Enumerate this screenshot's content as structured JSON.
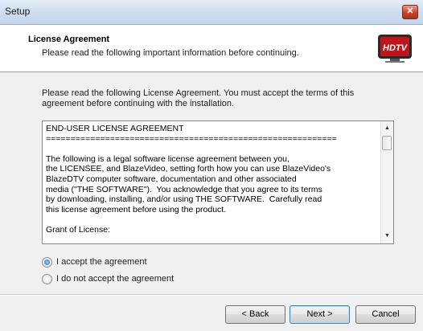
{
  "window": {
    "title": "Setup",
    "close_symbol": "✕"
  },
  "header": {
    "title": "License Agreement",
    "subtitle": "Please read the following important information before continuing.",
    "logo_text": "HDTV"
  },
  "body": {
    "intro": "Please read the following License Agreement. You must accept the terms of this agreement before continuing with the installation."
  },
  "license": {
    "lines": [
      "END-USER LICENSE AGREEMENT",
      "===========================================================",
      "",
      "The following is a legal software license agreement between you,",
      "the LICENSEE, and BlazeVideo, setting forth how you can use BlazeVideo's",
      "BlazeDTV computer software, documentation and other associated",
      "media (\"THE SOFTWARE\").  You acknowledge that you agree to its terms",
      "by downloading, installing, and/or using THE SOFTWARE.  Carefully read",
      "this license agreement before using the product.",
      "",
      "Grant of License:"
    ]
  },
  "radios": {
    "accept_label": "I accept the agreement",
    "decline_label": "I do not accept the agreement",
    "selected": "accept"
  },
  "buttons": {
    "back": "< Back",
    "next": "Next >",
    "cancel": "Cancel"
  },
  "colors": {
    "titlebar": "#cddcee",
    "close": "#c7432c",
    "logo_red": "#c0151b"
  }
}
